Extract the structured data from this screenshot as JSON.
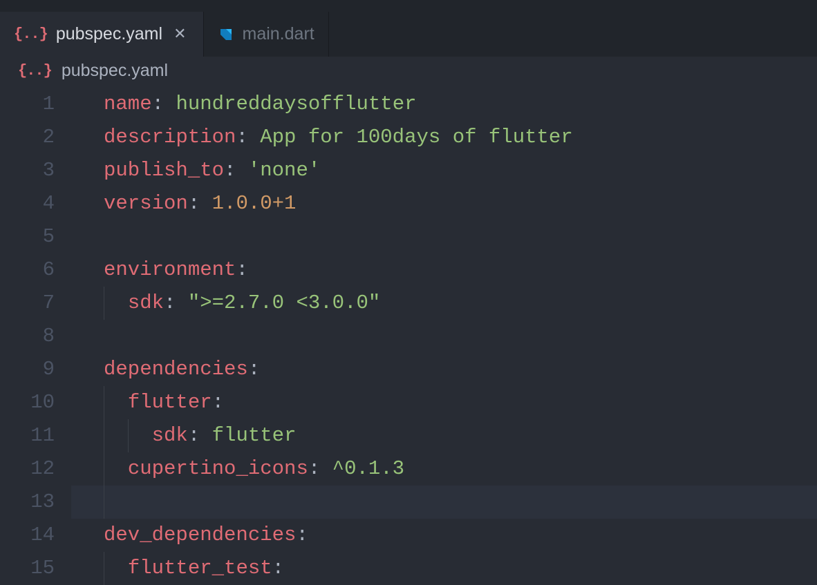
{
  "tabs": [
    {
      "label": "pubspec.yaml",
      "icon": "yaml",
      "active": true
    },
    {
      "label": "main.dart",
      "icon": "dart",
      "active": false
    }
  ],
  "breadcrumb": {
    "icon": "yaml",
    "label": "pubspec.yaml"
  },
  "code": {
    "lines": [
      {
        "n": "1",
        "tokens": [
          {
            "t": "key",
            "v": "name"
          },
          {
            "t": "punct",
            "v": ": "
          },
          {
            "t": "string",
            "v": "hundreddaysofflutter"
          }
        ]
      },
      {
        "n": "2",
        "tokens": [
          {
            "t": "key",
            "v": "description"
          },
          {
            "t": "punct",
            "v": ": "
          },
          {
            "t": "string",
            "v": "App for 100days of flutter"
          }
        ]
      },
      {
        "n": "3",
        "tokens": [
          {
            "t": "key",
            "v": "publish_to"
          },
          {
            "t": "punct",
            "v": ": "
          },
          {
            "t": "string",
            "v": "'none'"
          }
        ]
      },
      {
        "n": "4",
        "tokens": [
          {
            "t": "key",
            "v": "version"
          },
          {
            "t": "punct",
            "v": ": "
          },
          {
            "t": "number",
            "v": "1.0.0+1"
          }
        ]
      },
      {
        "n": "5",
        "tokens": []
      },
      {
        "n": "6",
        "tokens": [
          {
            "t": "key",
            "v": "environment"
          },
          {
            "t": "punct",
            "v": ":"
          }
        ]
      },
      {
        "n": "7",
        "indent": 1,
        "tokens": [
          {
            "t": "key",
            "v": "sdk"
          },
          {
            "t": "punct",
            "v": ": "
          },
          {
            "t": "string",
            "v": "\">=2.7.0 <3.0.0\""
          }
        ]
      },
      {
        "n": "8",
        "tokens": []
      },
      {
        "n": "9",
        "tokens": [
          {
            "t": "key",
            "v": "dependencies"
          },
          {
            "t": "punct",
            "v": ":"
          }
        ]
      },
      {
        "n": "10",
        "indent": 1,
        "tokens": [
          {
            "t": "key",
            "v": "flutter"
          },
          {
            "t": "punct",
            "v": ":"
          }
        ]
      },
      {
        "n": "11",
        "indent": 2,
        "tokens": [
          {
            "t": "key",
            "v": "sdk"
          },
          {
            "t": "punct",
            "v": ": "
          },
          {
            "t": "string",
            "v": "flutter"
          }
        ]
      },
      {
        "n": "12",
        "indent": 1,
        "tokens": [
          {
            "t": "key",
            "v": "cupertino_icons"
          },
          {
            "t": "punct",
            "v": ": "
          },
          {
            "t": "string",
            "v": "^0.1.3"
          }
        ]
      },
      {
        "n": "13",
        "indent": 1,
        "highlight": true,
        "tokens": []
      },
      {
        "n": "14",
        "tokens": [
          {
            "t": "key",
            "v": "dev_dependencies"
          },
          {
            "t": "punct",
            "v": ":"
          }
        ]
      },
      {
        "n": "15",
        "indent": 1,
        "tokens": [
          {
            "t": "key",
            "v": "flutter_test"
          },
          {
            "t": "punct",
            "v": ":"
          }
        ]
      }
    ]
  }
}
